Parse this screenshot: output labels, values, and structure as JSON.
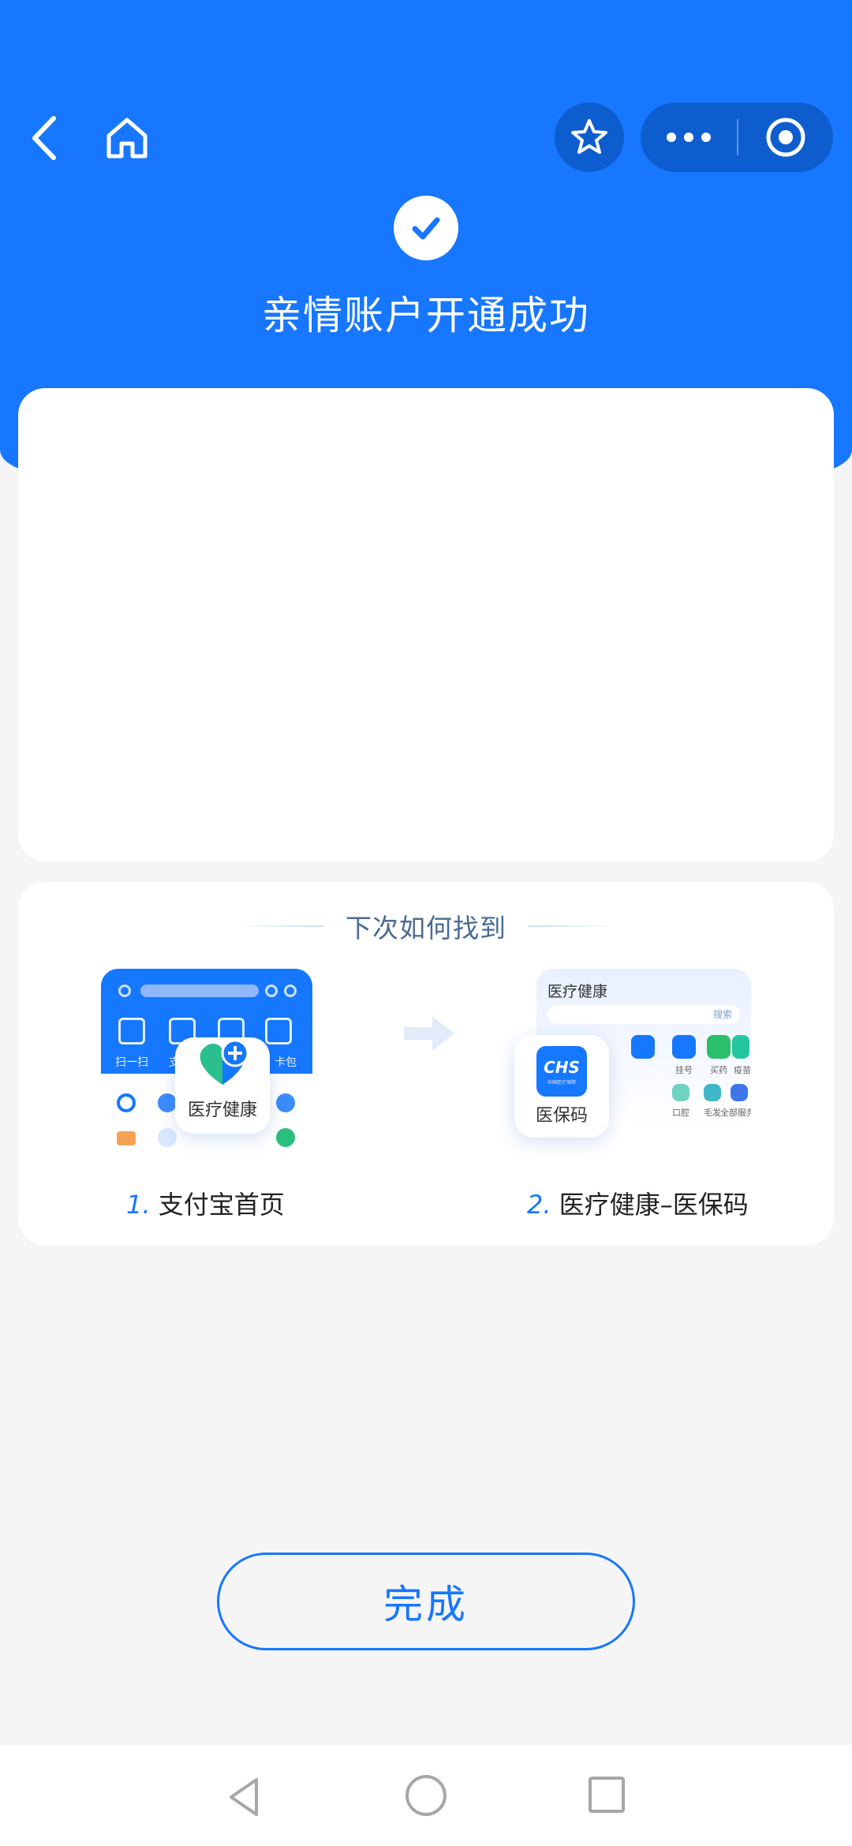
{
  "header": {
    "title": "亲情账户开通成功",
    "accent_color": "#1777ff",
    "icons": [
      "back-arrow-icon",
      "home-icon",
      "star-icon",
      "more-dots-icon",
      "close-target-icon",
      "checkmark-icon"
    ]
  },
  "guide": {
    "title": "下次如何找到",
    "step1": {
      "num": "1.",
      "text": "支付宝首页",
      "app_label": "医疗健康"
    },
    "step2": {
      "num": "2.",
      "text": "医疗健康–医保码",
      "app_label": "医保码",
      "mock_title": "医疗健康",
      "mock_search": "搜索"
    },
    "left_mock_labels": [
      "扫一扫",
      "支付",
      "卡包"
    ],
    "right_mock_labels": [
      "挂号",
      "买药",
      "疫苗",
      "口腔",
      "毛发",
      "全部服务"
    ],
    "chs_logo": "CHS",
    "chs_sub": "中国医疗保障"
  },
  "actions": {
    "done_label": "完成"
  },
  "system_nav": {
    "icons": [
      "back-triangle-icon",
      "home-circle-icon",
      "recents-square-icon"
    ]
  }
}
